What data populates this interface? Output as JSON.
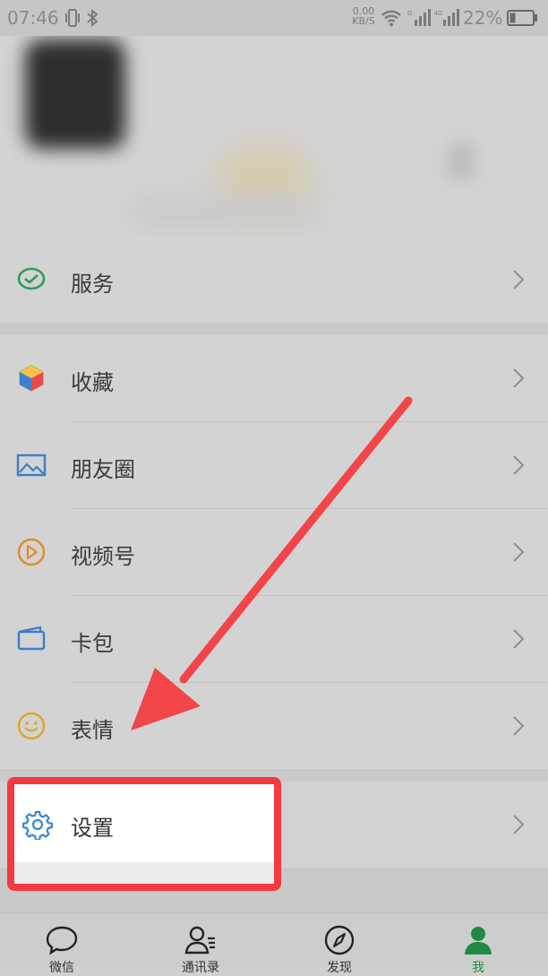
{
  "status_bar": {
    "time": "07:46",
    "net_speed_value": "0.00",
    "net_speed_unit": "KB/S",
    "battery": "22%",
    "icons": [
      "vibrate-icon",
      "bluetooth-icon",
      "wifi-icon",
      "signal-icon",
      "signal-4g-icon",
      "battery-icon"
    ]
  },
  "menu": {
    "service": {
      "label": "服务",
      "icon": "wechat-pay-icon"
    },
    "items": [
      {
        "label": "收藏",
        "icon": "cube-icon"
      },
      {
        "label": "朋友圈",
        "icon": "picture-icon"
      },
      {
        "label": "视频号",
        "icon": "play-circle-icon"
      },
      {
        "label": "卡包",
        "icon": "wallet-icon"
      },
      {
        "label": "表情",
        "icon": "smiley-icon"
      }
    ],
    "settings": {
      "label": "设置",
      "icon": "gear-icon"
    }
  },
  "tabbar": {
    "tabs": [
      {
        "label": "微信",
        "icon": "chat-bubble-icon",
        "active": false
      },
      {
        "label": "通讯录",
        "icon": "contacts-icon",
        "active": false
      },
      {
        "label": "发现",
        "icon": "compass-icon",
        "active": false
      },
      {
        "label": "我",
        "icon": "person-icon",
        "active": true
      }
    ]
  },
  "colors": {
    "accent_green": "#1f8a46",
    "highlight_red": "#f23a3f",
    "arrow_red": "#f2454a"
  }
}
